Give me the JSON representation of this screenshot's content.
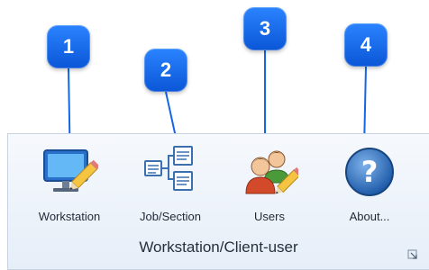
{
  "ribbon": {
    "buttons": [
      {
        "label": "Workstation",
        "icon": "monitor-pencil-icon"
      },
      {
        "label": "Job/Section",
        "icon": "tree-sections-icon"
      },
      {
        "label": "Users",
        "icon": "users-pencil-icon"
      },
      {
        "label": "About...",
        "icon": "question-icon"
      }
    ],
    "group_label": "Workstation/Client-user",
    "dialog_launcher_icon": "dialog-launcher-icon"
  },
  "callouts": [
    "1",
    "2",
    "3",
    "4"
  ],
  "colors": {
    "callout": "#1565e8",
    "ribbon_bg": "#eaf1fa",
    "ribbon_border": "#c8d3e1"
  }
}
